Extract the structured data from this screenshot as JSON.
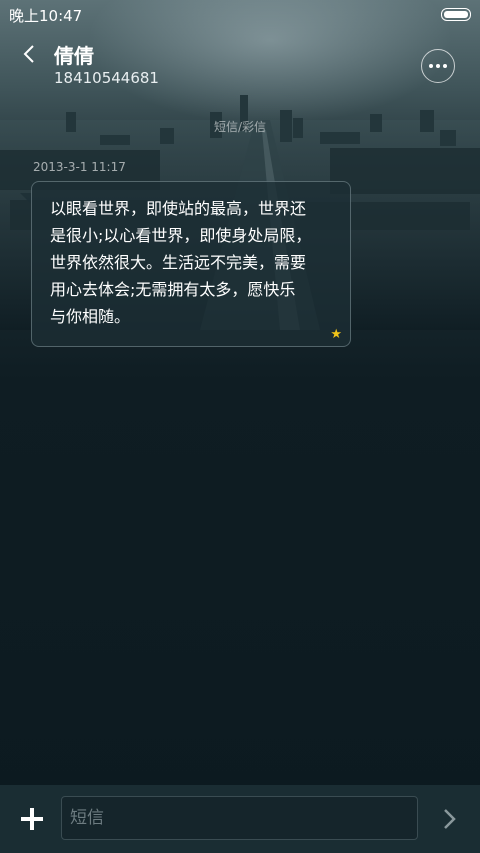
{
  "status_bar": {
    "time": "晚上10:47"
  },
  "header": {
    "name": "倩倩",
    "number": "18410544681"
  },
  "thread": {
    "type_label": "短信/彩信",
    "message": {
      "time": "2013-3-1 11:17",
      "lines": [
        "以眼看世界，即使站的最高，世界还",
        "是很小;以心看世界，即使身处局限，",
        "世界依然很大。生活远不完美，需要",
        "用心去体会;无需拥有太多，愿快乐",
        "与你相随。"
      ]
    }
  },
  "input": {
    "placeholder": "短信"
  },
  "icons": {
    "back": "chevron-left-icon",
    "more": "more-icon",
    "add": "plus-icon",
    "send": "chevron-right-icon",
    "star": "star-icon",
    "battery": "battery-icon"
  },
  "colors": {
    "star": "#f0c419",
    "background": "#0e1c22"
  }
}
